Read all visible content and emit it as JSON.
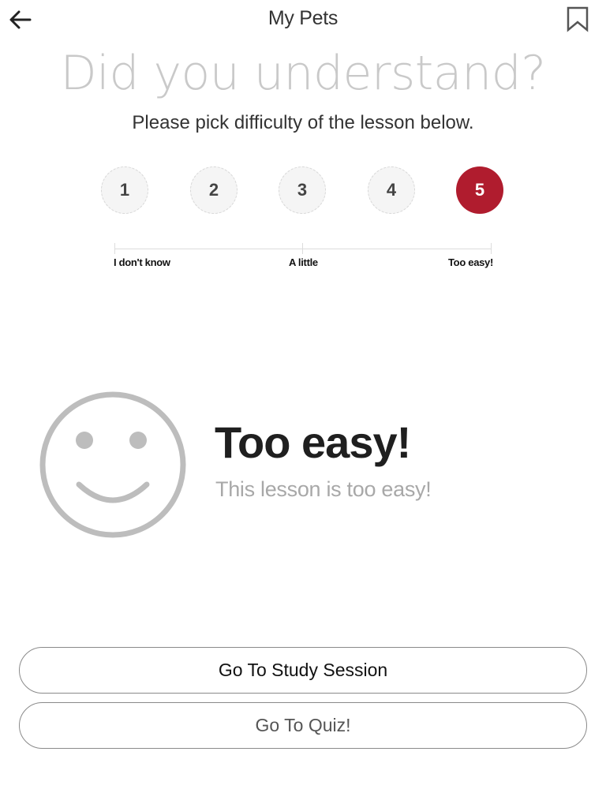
{
  "header": {
    "title": "My Pets",
    "back_icon": "arrow-left-icon",
    "bookmark_icon": "bookmark-icon"
  },
  "question": {
    "headline": "Did you understand?",
    "instruction": "Please pick difficulty of the lesson below."
  },
  "rating": {
    "options": [
      "1",
      "2",
      "3",
      "4",
      "5"
    ],
    "selected": "5",
    "selected_color": "#b01c2e",
    "scale_labels": {
      "low": "I don't know",
      "mid": "A little",
      "high": "Too easy!"
    }
  },
  "result": {
    "icon": "smiley-face-icon",
    "title": "Too easy!",
    "description": "This lesson is too easy!"
  },
  "actions": {
    "study_label": "Go To Study Session",
    "quiz_label": "Go To Quiz!"
  }
}
